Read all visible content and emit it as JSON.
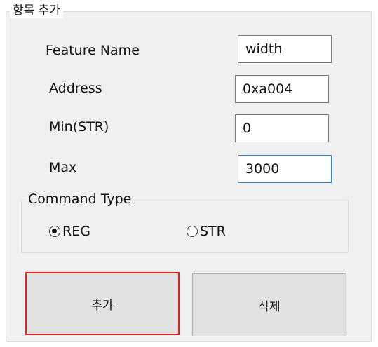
{
  "group_title": "항목 추가",
  "fields": [
    {
      "label": "Feature Name",
      "value": "width"
    },
    {
      "label": "Address",
      "value": "0xa004"
    },
    {
      "label": "Min(STR)",
      "value": "0"
    },
    {
      "label": "Max",
      "value": "3000"
    }
  ],
  "command_type": {
    "title": "Command Type",
    "options": [
      {
        "label": "REG",
        "checked": true
      },
      {
        "label": "STR",
        "checked": false
      }
    ]
  },
  "buttons": {
    "add_label": "추가",
    "delete_label": "삭제"
  }
}
